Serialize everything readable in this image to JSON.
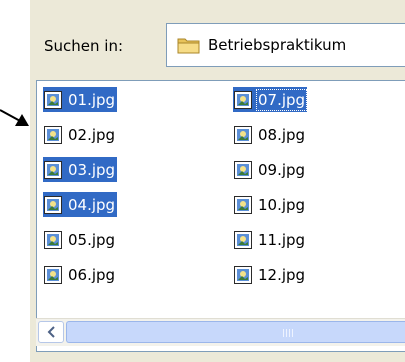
{
  "look_in": {
    "label": "Suchen in:",
    "folder": "Betriebspraktikum"
  },
  "files": [
    {
      "name": "01.jpg",
      "selected": true,
      "focused": false
    },
    {
      "name": "02.jpg",
      "selected": false,
      "focused": false
    },
    {
      "name": "03.jpg",
      "selected": true,
      "focused": false
    },
    {
      "name": "04.jpg",
      "selected": true,
      "focused": false
    },
    {
      "name": "05.jpg",
      "selected": false,
      "focused": false
    },
    {
      "name": "06.jpg",
      "selected": false,
      "focused": false
    },
    {
      "name": "07.jpg",
      "selected": true,
      "focused": true
    },
    {
      "name": "08.jpg",
      "selected": false,
      "focused": false
    },
    {
      "name": "09.jpg",
      "selected": false,
      "focused": false
    },
    {
      "name": "10.jpg",
      "selected": false,
      "focused": false
    },
    {
      "name": "11.jpg",
      "selected": false,
      "focused": false
    },
    {
      "name": "12.jpg",
      "selected": false,
      "focused": false
    }
  ],
  "icons": {
    "file": "image-file-icon",
    "folder": "folder-icon",
    "scroll_left": "arrow-left-icon"
  },
  "colors": {
    "selection": "#316ac5",
    "dialog_bg": "#ece9d8",
    "border": "#7f9db9"
  }
}
